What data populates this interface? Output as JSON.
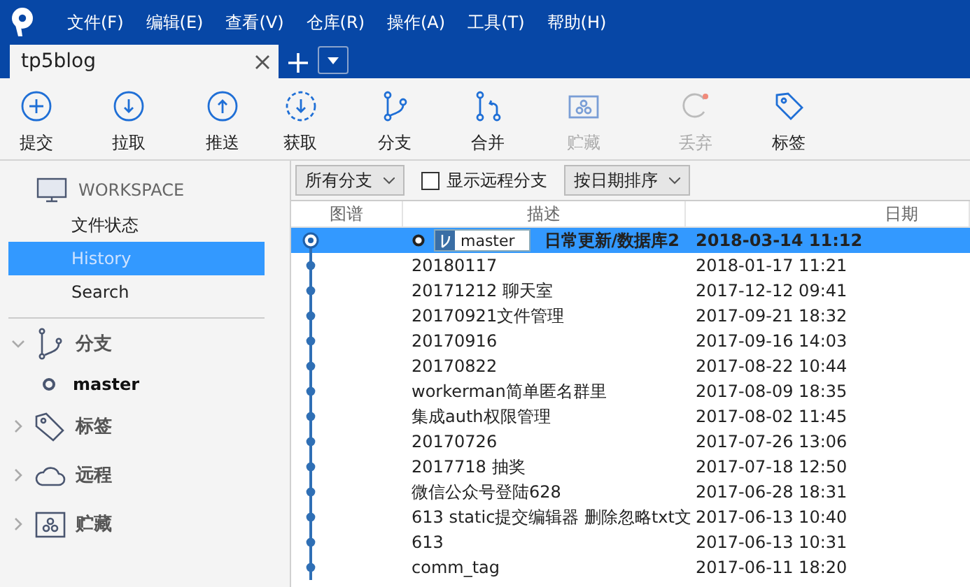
{
  "menu": [
    "文件(F)",
    "编辑(E)",
    "查看(V)",
    "仓库(R)",
    "操作(A)",
    "工具(T)",
    "帮助(H)"
  ],
  "tabs": [
    {
      "label": "tp5blog",
      "selected": true
    }
  ],
  "toolbar": [
    {
      "kind": "commit",
      "label": "提交",
      "disabled": false
    },
    {
      "kind": "pull",
      "label": "拉取",
      "disabled": false
    },
    {
      "kind": "push",
      "label": "推送",
      "disabled": false
    },
    {
      "kind": "fetch",
      "label": "获取",
      "disabled": false
    },
    {
      "kind": "branch",
      "label": "分支",
      "disabled": false
    },
    {
      "kind": "merge",
      "label": "合并",
      "disabled": false
    },
    {
      "kind": "stash",
      "label": "贮藏",
      "disabled": true
    },
    {
      "kind": "discard",
      "label": "丢弃",
      "disabled": true
    },
    {
      "kind": "tag",
      "label": "标签",
      "disabled": false
    }
  ],
  "sidebar": {
    "workspace": {
      "title": "WORKSPACE",
      "items": [
        {
          "label": "文件状态",
          "selected": false
        },
        {
          "label": "History",
          "selected": true
        },
        {
          "label": "Search",
          "selected": false
        }
      ]
    },
    "groups": [
      {
        "kind": "branch",
        "label": "分支",
        "expanded": true,
        "children": [
          {
            "label": "master"
          }
        ]
      },
      {
        "kind": "tag",
        "label": "标签",
        "expanded": false
      },
      {
        "kind": "remote",
        "label": "远程",
        "expanded": false
      },
      {
        "kind": "stash",
        "label": "贮藏",
        "expanded": false
      }
    ]
  },
  "filters": {
    "branch_select": "所有分支",
    "show_remote": {
      "label": "显示远程分支",
      "checked": false
    },
    "sort_select": "按日期排序"
  },
  "table": {
    "columns": [
      "图谱",
      "描述",
      "日期"
    ],
    "rows": [
      {
        "kind": "head",
        "branch": "master",
        "description": "日常更新/数据库2",
        "date": "2018-03-14 11:12",
        "selected": true
      },
      {
        "kind": "commit",
        "description": "20180117",
        "date": "2018-01-17 11:21",
        "selected": false
      },
      {
        "kind": "commit",
        "description": "20171212 聊天室",
        "date": "2017-12-12 09:41",
        "selected": false
      },
      {
        "kind": "commit",
        "description": "20170921文件管理",
        "date": "2017-09-21 18:32",
        "selected": false
      },
      {
        "kind": "commit",
        "description": "20170916",
        "date": "2017-09-16 14:03",
        "selected": false
      },
      {
        "kind": "commit",
        "description": "20170822",
        "date": "2017-08-22 10:44",
        "selected": false
      },
      {
        "kind": "commit",
        "description": "workerman简单匿名群里",
        "date": "2017-08-09 18:35",
        "selected": false
      },
      {
        "kind": "commit",
        "description": "集成auth权限管理",
        "date": "2017-08-02 11:45",
        "selected": false
      },
      {
        "kind": "commit",
        "description": "20170726",
        "date": "2017-07-26 13:06",
        "selected": false
      },
      {
        "kind": "commit",
        "description": "2017718 抽奖",
        "date": "2017-07-18 12:50",
        "selected": false
      },
      {
        "kind": "commit",
        "description": "微信公众号登陆628",
        "date": "2017-06-28 18:31",
        "selected": false
      },
      {
        "kind": "commit",
        "description": "613 static提交编辑器 删除忽略txt文",
        "date": "2017-06-13 10:40",
        "selected": false
      },
      {
        "kind": "commit",
        "description": "613",
        "date": "2017-06-13 10:31",
        "selected": false
      },
      {
        "kind": "commit",
        "description": "comm_tag",
        "date": "2017-06-11 18:20",
        "selected": false
      }
    ]
  }
}
